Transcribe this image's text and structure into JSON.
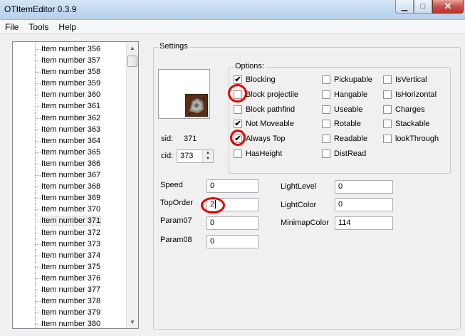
{
  "window": {
    "title": "OTItemEditor 0.3.9",
    "min_label": "▁",
    "max_label": "□",
    "close_label": "✕"
  },
  "menu": [
    "File",
    "Tools",
    "Help"
  ],
  "items": [
    "Item number 356",
    "Item number 357",
    "Item number 358",
    "Item number 359",
    "Item number 360",
    "Item number 361",
    "Item number 362",
    "Item number 363",
    "Item number 364",
    "Item number 365",
    "Item number 366",
    "Item number 367",
    "Item number 368",
    "Item number 369",
    "Item number 370",
    "Item number 371",
    "Item number 372",
    "Item number 373",
    "Item number 374",
    "Item number 375",
    "Item number 376",
    "Item number 377",
    "Item number 378",
    "Item number 379",
    "Item number 380"
  ],
  "selected_item": "Item number 371",
  "settings": {
    "title": "Settings",
    "sid_label": "sid:",
    "sid_value": "371",
    "cid_label": "cid:",
    "cid_value": "373",
    "options_title": "Options:",
    "options": [
      {
        "label": "Blocking",
        "checked": true
      },
      {
        "label": "Block projectile",
        "checked": false
      },
      {
        "label": "Block pathfind",
        "checked": false
      },
      {
        "label": "Not Moveable",
        "checked": true
      },
      {
        "label": "Always Top",
        "checked": true
      },
      {
        "label": "HasHeight",
        "checked": false
      },
      {
        "label": "Pickupable",
        "checked": false
      },
      {
        "label": "Hangable",
        "checked": false
      },
      {
        "label": "Useable",
        "checked": false
      },
      {
        "label": "Rotable",
        "checked": false
      },
      {
        "label": "Readable",
        "checked": false
      },
      {
        "label": "DistRead",
        "checked": false
      },
      {
        "label": "IsVertical",
        "checked": false
      },
      {
        "label": "IsHorizontal",
        "checked": false
      },
      {
        "label": "Charges",
        "checked": false
      },
      {
        "label": "Stackable",
        "checked": false
      },
      {
        "label": "lookThrough",
        "checked": false
      }
    ],
    "fields": {
      "speed": {
        "label": "Speed",
        "value": "0"
      },
      "toporder": {
        "label": "TopOrder",
        "value": "2"
      },
      "param07": {
        "label": "Param07",
        "value": "0"
      },
      "param08": {
        "label": "Param08",
        "value": "0"
      },
      "lightlevel": {
        "label": "LightLevel",
        "value": "0"
      },
      "lightcolor": {
        "label": "LightColor",
        "value": "0"
      },
      "minimapcolor": {
        "label": "MinimapColor",
        "value": "114"
      }
    }
  },
  "colors": {
    "annotation_red": "#e00000",
    "titlebar": "#c2d8f0"
  }
}
